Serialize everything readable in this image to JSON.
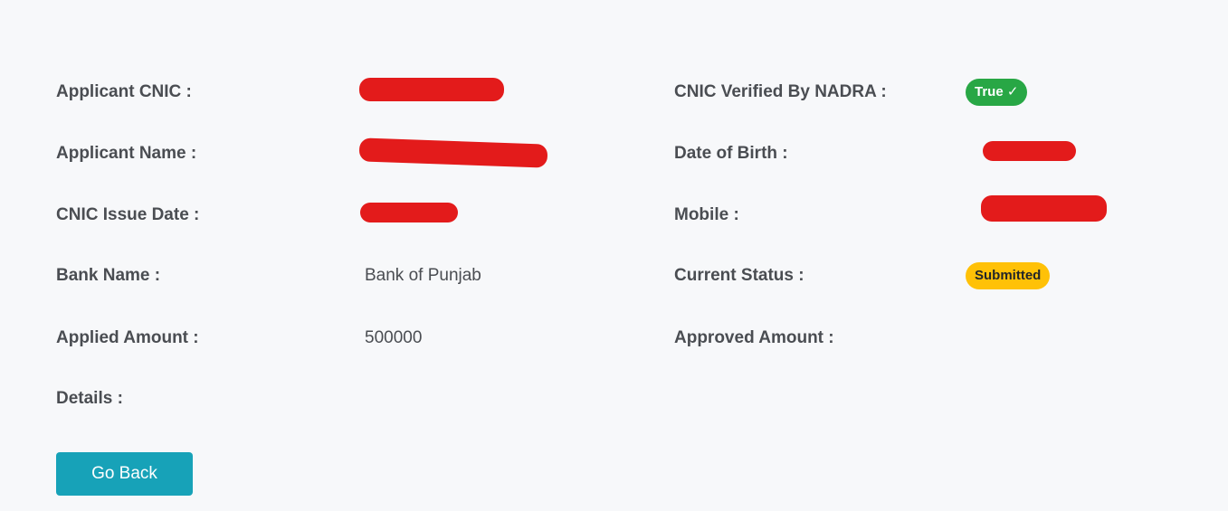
{
  "fields": {
    "applicant_cnic": {
      "label": "Applicant CNIC :",
      "value": ""
    },
    "applicant_name": {
      "label": "Applicant Name :",
      "value": ""
    },
    "cnic_issue_date": {
      "label": "CNIC Issue Date :",
      "value": ""
    },
    "bank_name": {
      "label": "Bank Name :",
      "value": "Bank of Punjab"
    },
    "applied_amount": {
      "label": "Applied Amount :",
      "value": "500000"
    },
    "details": {
      "label": "Details :",
      "value": ""
    },
    "cnic_verified": {
      "label": "CNIC Verified By NADRA :",
      "value": "True ✓"
    },
    "date_of_birth": {
      "label": "Date of Birth :",
      "value": ""
    },
    "mobile": {
      "label": "Mobile :",
      "value": ""
    },
    "current_status": {
      "label": "Current Status :",
      "value": "Submitted"
    },
    "approved_amount": {
      "label": "Approved Amount :",
      "value": ""
    }
  },
  "actions": {
    "go_back_label": "Go Back"
  },
  "colors": {
    "badge_success": "#28a745",
    "badge_warning": "#ffc107",
    "button": "#17a2b8",
    "redaction": "#e31b1b"
  }
}
